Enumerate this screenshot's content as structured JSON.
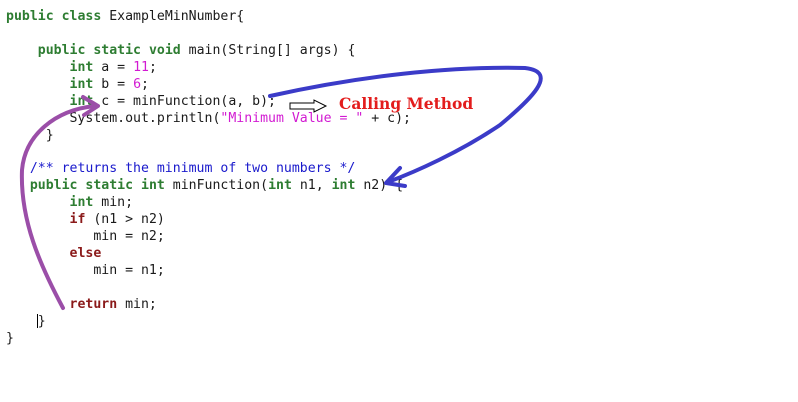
{
  "code": {
    "l1_public": "public",
    "l1_class": "class",
    "l1_name": " ExampleMinNumber{",
    "l3_public": "public",
    "l3_static": "static",
    "l3_void": "void",
    "l3_rest": " main(String[] args) {",
    "l4_int": "int",
    "l4_mid": " a = ",
    "l4_num": "11",
    "l4_end": ";",
    "l5_int": "int",
    "l5_mid": " b = ",
    "l5_num": "6",
    "l5_end": ";",
    "l6_int": "int",
    "l6_rest": " c = minFunction(a, b);",
    "l7_start": "System.out.println(",
    "l7_str": "\"Minimum Value = \"",
    "l7_end": " + c);",
    "l8": "}",
    "l10_comment": "/** returns the minimum of two numbers */",
    "l11_public": "public",
    "l11_static": "static",
    "l11_int": "int",
    "l11_mid": " minFunction(",
    "l11_int2": "int",
    "l11_n1": " n1, ",
    "l11_int3": "int",
    "l11_end": " n2) {",
    "l12_int": "int",
    "l12_rest": " min;",
    "l13_if": "if",
    "l13_rest": " (n1 > n2)",
    "l14": "min = n2;",
    "l15_else": "else",
    "l16": "min = n1;",
    "l18_return": "return",
    "l18_rest": " min;",
    "l19": "}",
    "l20": "}"
  },
  "annotation": {
    "label": "Calling Method",
    "label_color": "#e31c1c",
    "call_arrow_color": "#3b3bc8",
    "return_arrow_color": "#9b4ea8",
    "pointer_icon": "outline-right-arrow-icon"
  }
}
